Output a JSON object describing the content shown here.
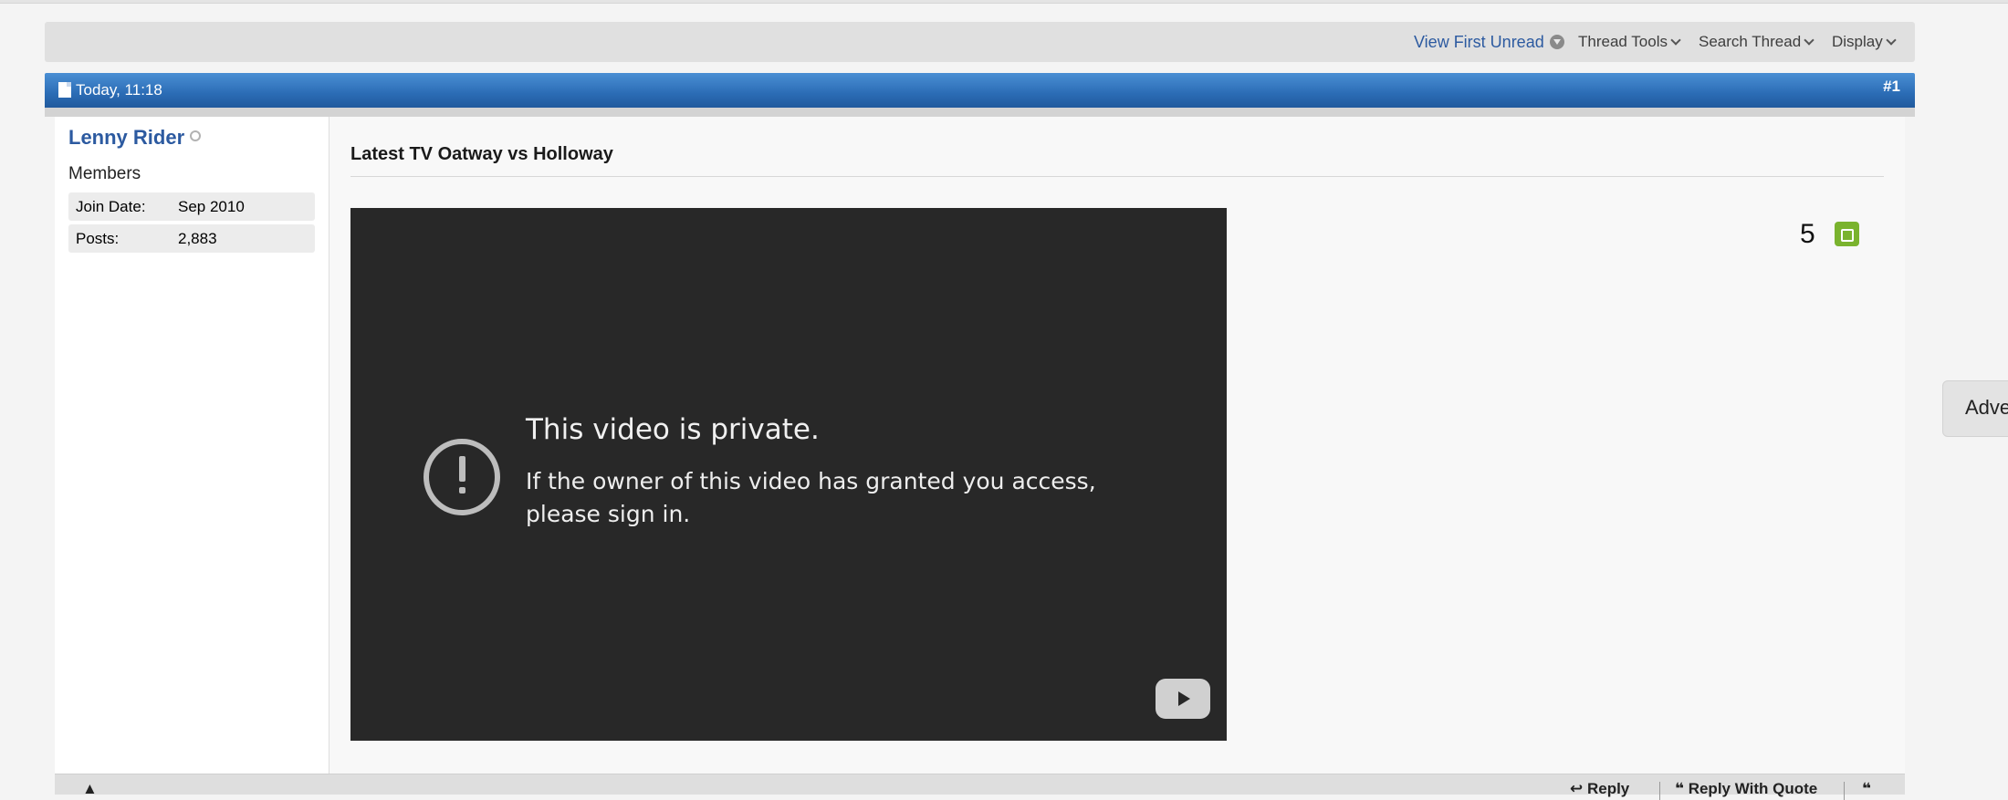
{
  "controls": {
    "view_first_unread": "View First Unread",
    "thread_tools": "Thread Tools",
    "search_thread": "Search Thread",
    "display": "Display"
  },
  "post": {
    "date": "Today, 11:18",
    "number": "#1",
    "title": "Latest TV Oatway vs Holloway",
    "reputation": "5"
  },
  "user": {
    "name": "Lenny Rider",
    "title": "Members",
    "stats": [
      {
        "label": "Join Date:",
        "value": "Sep 2010"
      },
      {
        "label": "Posts:",
        "value": "2,883"
      }
    ]
  },
  "video": {
    "title": "This video is private.",
    "message": "If the owner of this video has granted you access, please sign in."
  },
  "footer": {
    "reply": "Reply",
    "reply_with_quote": "Reply With Quote"
  },
  "sidebar_tab": {
    "label": "Adve"
  }
}
